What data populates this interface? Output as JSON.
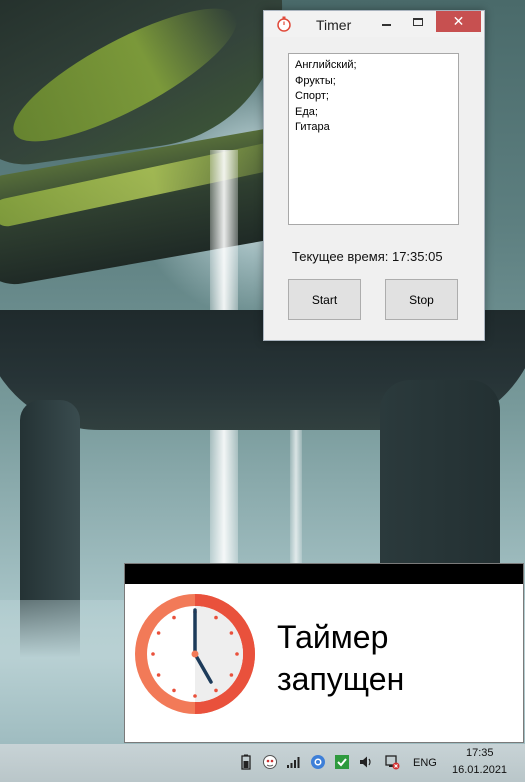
{
  "window": {
    "title": "Timer",
    "close_glyph": "✕"
  },
  "list": {
    "items": [
      "Английский;",
      "Фрукты;",
      "Спорт;",
      "Еда;",
      "Гитара"
    ]
  },
  "status": {
    "current_time": "Текущее время: 17:35:05"
  },
  "buttons": {
    "start_label": "Start",
    "stop_label": "Stop"
  },
  "notification": {
    "line1": "Таймер",
    "line2": "запущен",
    "icon": "clock-icon"
  },
  "taskbar": {
    "language": "ENG",
    "time": "17:35",
    "date": "16.01.2021",
    "tray_icons": [
      "battery-icon",
      "antivirus-icon",
      "signal-icon",
      "browser-icon",
      "checkmark-icon",
      "volume-icon",
      "network-icon"
    ]
  },
  "colors": {
    "close_button": "#c75050",
    "clock_face": "#f27a58",
    "clock_ring": "#e9513c",
    "clock_hand": "#1d3b5a"
  }
}
